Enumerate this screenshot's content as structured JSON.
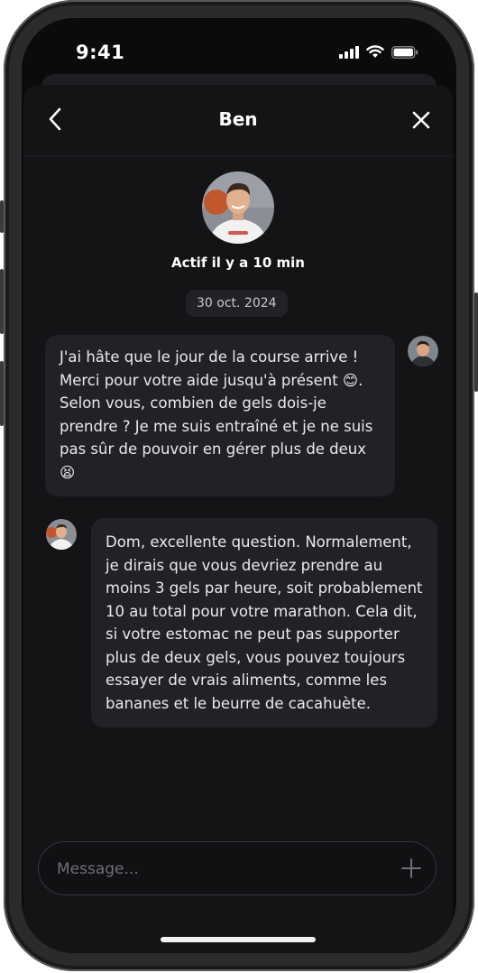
{
  "status_bar": {
    "time": "9:41"
  },
  "header": {
    "title": "Ben"
  },
  "profile": {
    "active_status": "Actif il y a 10 min"
  },
  "date_separator": "30 oct. 2024",
  "messages": [
    {
      "sender": "me",
      "text": "J'ai hâte que le jour de la course arrive ! Merci pour votre aide jusqu'à présent 😊. Selon vous, combien de gels dois-je prendre ? Je me suis entraîné et je ne suis pas sûr de pouvoir en gérer plus de deux 😫"
    },
    {
      "sender": "Ben",
      "text": "Dom, excellente question. Normalement, je dirais que vous devriez prendre au moins 3 gels par heure, soit probablement 10 au total pour votre marathon. Cela dit, si votre estomac ne peut pas supporter plus de deux gels, vous pouvez toujours essayer de vrais aliments, comme les bananes et le beurre de cacahuète."
    }
  ],
  "composer": {
    "placeholder": "Message..."
  },
  "colors": {
    "background": "#0b0b0c",
    "sheet": "#141416",
    "bubble": "#202227",
    "text": "#e9eaec"
  }
}
